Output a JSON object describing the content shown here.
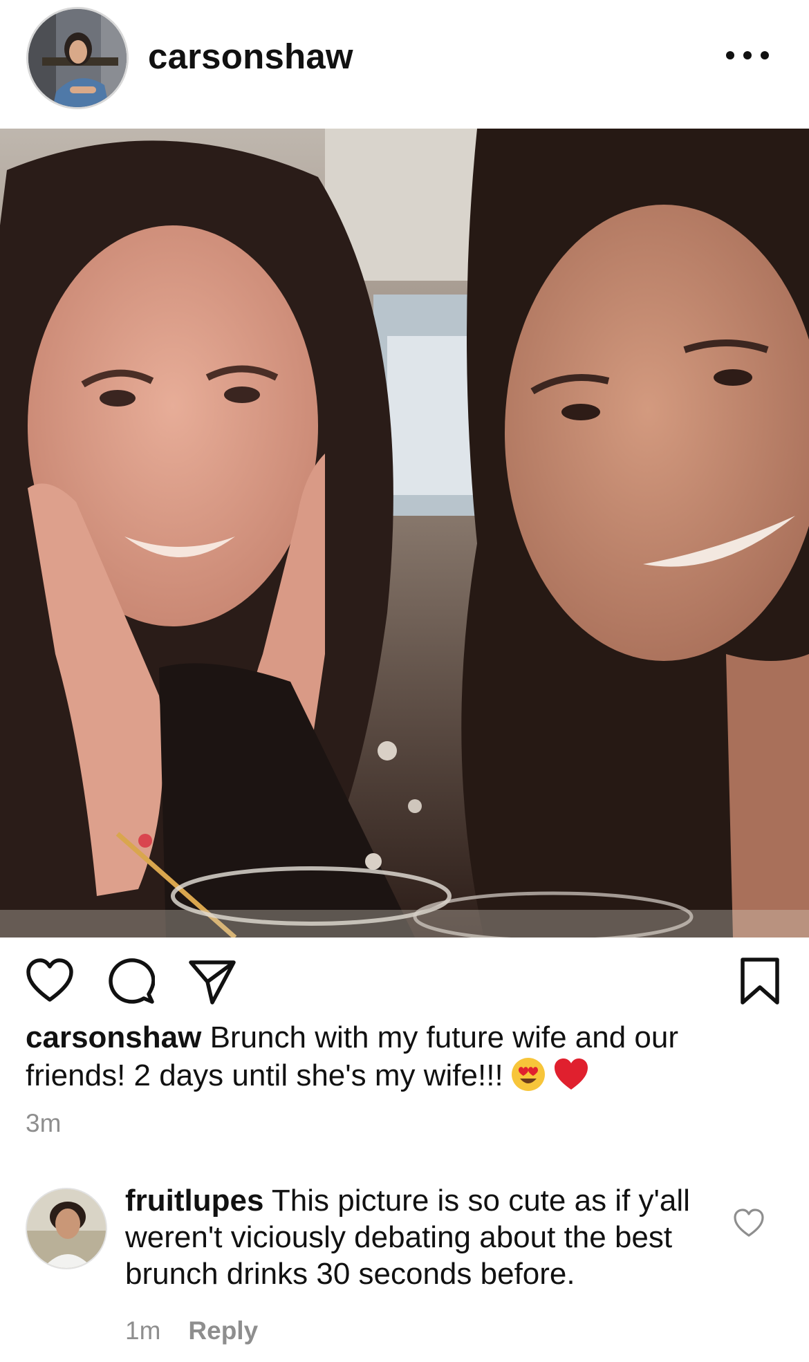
{
  "post": {
    "username": "carsonshaw",
    "more_icon": "more-horizontal-icon",
    "actions": {
      "like_icon": "heart-icon",
      "comment_icon": "comment-icon",
      "share_icon": "send-icon",
      "save_icon": "bookmark-icon"
    },
    "caption": {
      "username": "carsonshaw",
      "text": " Brunch with my future wife and our friends! 2 days until she's my wife!!!",
      "emojis": [
        "heart-eyes-emoji",
        "red-heart-emoji"
      ]
    },
    "timestamp": "3m"
  },
  "comment": {
    "username": "fruitlupes",
    "text": " This picture is so cute as if y'all weren't viciously debating about the best brunch drinks 30 seconds before.",
    "time": "1m",
    "reply_label": "Reply",
    "like_icon": "heart-outline-icon"
  },
  "colors": {
    "text": "#111111",
    "secondary": "#8e8e8e",
    "emoji_heart": "#e0202e",
    "emoji_face": "#f7c53a"
  }
}
